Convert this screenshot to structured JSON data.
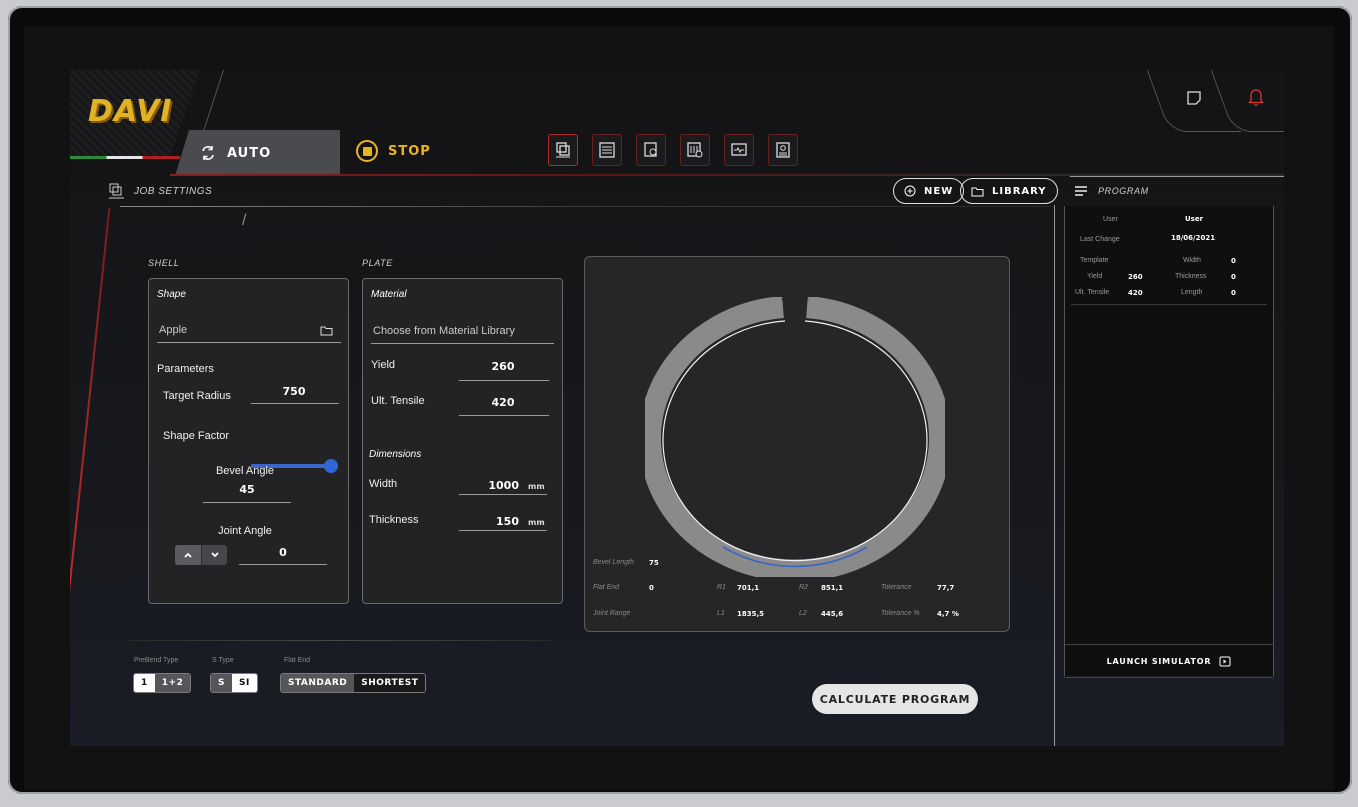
{
  "brand": {
    "logo": "DAVI"
  },
  "topbar": {
    "mode_label": "AUTO",
    "stop_label": "STOP",
    "tools": [
      "job-settings-icon",
      "program-list-icon",
      "search-doc-icon",
      "machine-settings-icon",
      "monitor-icon",
      "report-icon"
    ],
    "accent": "#e9b41c",
    "alert_color": "#d23a3a"
  },
  "job": {
    "title": "JOB SETTINGS",
    "new_label": "NEW",
    "library_label": "LIBRARY",
    "breadcrumb_sep": "/"
  },
  "shell": {
    "section": "SHELL",
    "card_title": "Shape",
    "shape_value": "Apple",
    "parameters_label": "Parameters",
    "target_radius_label": "Target Radius",
    "target_radius": "750",
    "shape_factor_label": "Shape Factor",
    "shape_factor_level": 1.0,
    "bevel_angle_label": "Bevel Angle",
    "bevel_angle": "45",
    "joint_angle_label": "Joint Angle",
    "joint_angle": "0"
  },
  "plate": {
    "section": "PLATE",
    "card_title": "Material",
    "material_placeholder": "Choose from Material Library",
    "yield_label": "Yield",
    "yield": "260",
    "ult_label": "Ult. Tensile",
    "ult": "420",
    "dimensions_label": "Dimensions",
    "width_label": "Width",
    "width": "1000",
    "thickness_label": "Thickness",
    "thickness": "150",
    "unit": "mm"
  },
  "diagram": {
    "bevel_length_label": "Bevel Length",
    "bevel_length": "75",
    "flat_end_label": "Flat End",
    "flat_end": "0",
    "joint_range_label": "Joint Range",
    "r1_label": "R1",
    "r1": "701,1",
    "r2_label": "R2",
    "r2": "851,1",
    "l1_label": "L1",
    "l1": "1835,5",
    "l2_label": "L2",
    "l2": "445,6",
    "tolerance_label": "Tolerance",
    "tolerance": "77,7",
    "tolerance_pct_label": "Tolerance %",
    "tolerance_pct": "4,7 %"
  },
  "options": {
    "prebend_label": "PreBend Type",
    "prebend": [
      "1",
      "1+2"
    ],
    "stype_label": "S Type",
    "stype": [
      "S",
      "SI"
    ],
    "flatend_label": "Flat End",
    "flatend": [
      "STANDARD",
      "SHORTEST"
    ]
  },
  "calculate_label": "CALCULATE PROGRAM",
  "program": {
    "title": "PROGRAM",
    "user_label": "User",
    "user": "User",
    "last_change_label": "Last Change",
    "last_change": "18/06/2021",
    "template_label": "Template",
    "yield_label": "Yield",
    "yield": "260",
    "ult_label": "Ult. Tensile",
    "ult": "420",
    "width_label": "Width",
    "width": "0",
    "thickness_label": "Thickness",
    "thickness": "0",
    "length_label": "Length",
    "length": "0",
    "launch_label": "LAUNCH SIMULATOR"
  }
}
